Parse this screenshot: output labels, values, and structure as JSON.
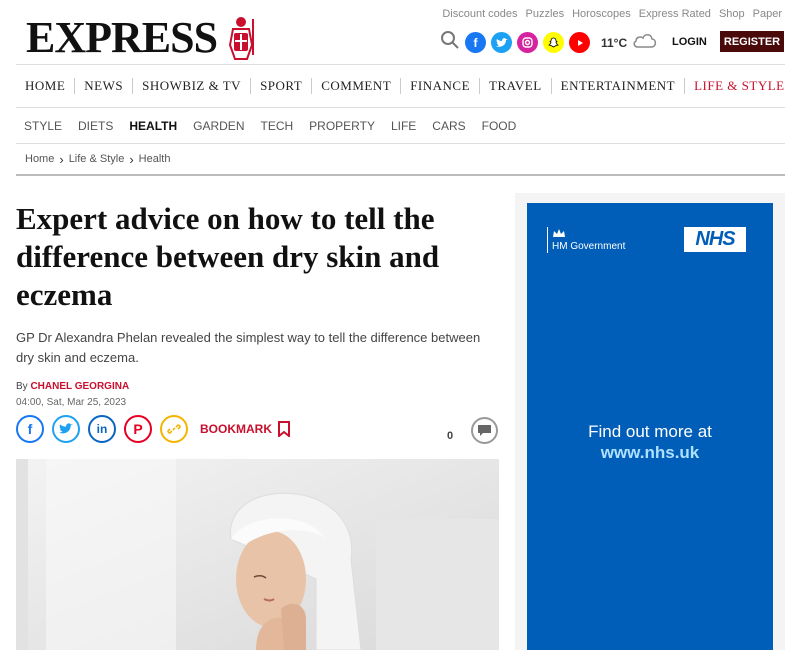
{
  "site": {
    "logo_text": "EXPRESS",
    "top_links": [
      "Discount codes",
      "Puzzles",
      "Horoscopes",
      "Express Rated",
      "Shop",
      "Paper"
    ],
    "social_icons": [
      "search-icon",
      "facebook-icon",
      "twitter-icon",
      "instagram-icon",
      "snapchat-icon",
      "youtube-icon"
    ],
    "weather": {
      "temp": "11°C",
      "icon": "cloud-icon"
    },
    "login_label": "LOGIN",
    "register_label": "REGISTER"
  },
  "nav": {
    "main": [
      "HOME",
      "NEWS",
      "SHOWBIZ & TV",
      "SPORT",
      "COMMENT",
      "FINANCE",
      "TRAVEL",
      "ENTERTAINMENT",
      "LIFE & STYLE"
    ],
    "sub": [
      "STYLE",
      "DIETS",
      "HEALTH",
      "GARDEN",
      "TECH",
      "PROPERTY",
      "LIFE",
      "CARS",
      "FOOD"
    ],
    "active_sub": "HEALTH"
  },
  "breadcrumb": [
    "Home",
    "Life & Style",
    "Health"
  ],
  "article": {
    "headline": "Expert advice on how to tell the difference between dry skin and eczema",
    "standfirst": "GP Dr Alexandra Phelan revealed the simplest way to tell the difference between dry skin and eczema.",
    "by_prefix": "By",
    "author": "CHANEL GEORGINA",
    "date": "04:00, Sat, Mar 25, 2023",
    "bookmark_label": "BOOKMARK",
    "comment_count": "0"
  },
  "share_buttons": [
    {
      "name": "facebook-share-button",
      "glyph": "f",
      "color": "#1877f2"
    },
    {
      "name": "twitter-share-button",
      "glyph": "t",
      "color": "#1da1f2"
    },
    {
      "name": "linkedin-share-button",
      "glyph": "in",
      "color": "#0a66c2"
    },
    {
      "name": "pinterest-share-button",
      "glyph": "P",
      "color": "#e60023"
    },
    {
      "name": "copy-link-button",
      "glyph": "⛓",
      "color": "#f5b400"
    }
  ],
  "ad": {
    "government_label": "HM Government",
    "nhs_logo": "NHS",
    "cta": "Find out more at",
    "url": "www.nhs.uk"
  },
  "colors": {
    "accent_red": "#c8102e",
    "register_bg": "#4a0a0a",
    "nhs_blue": "#005eb8"
  }
}
